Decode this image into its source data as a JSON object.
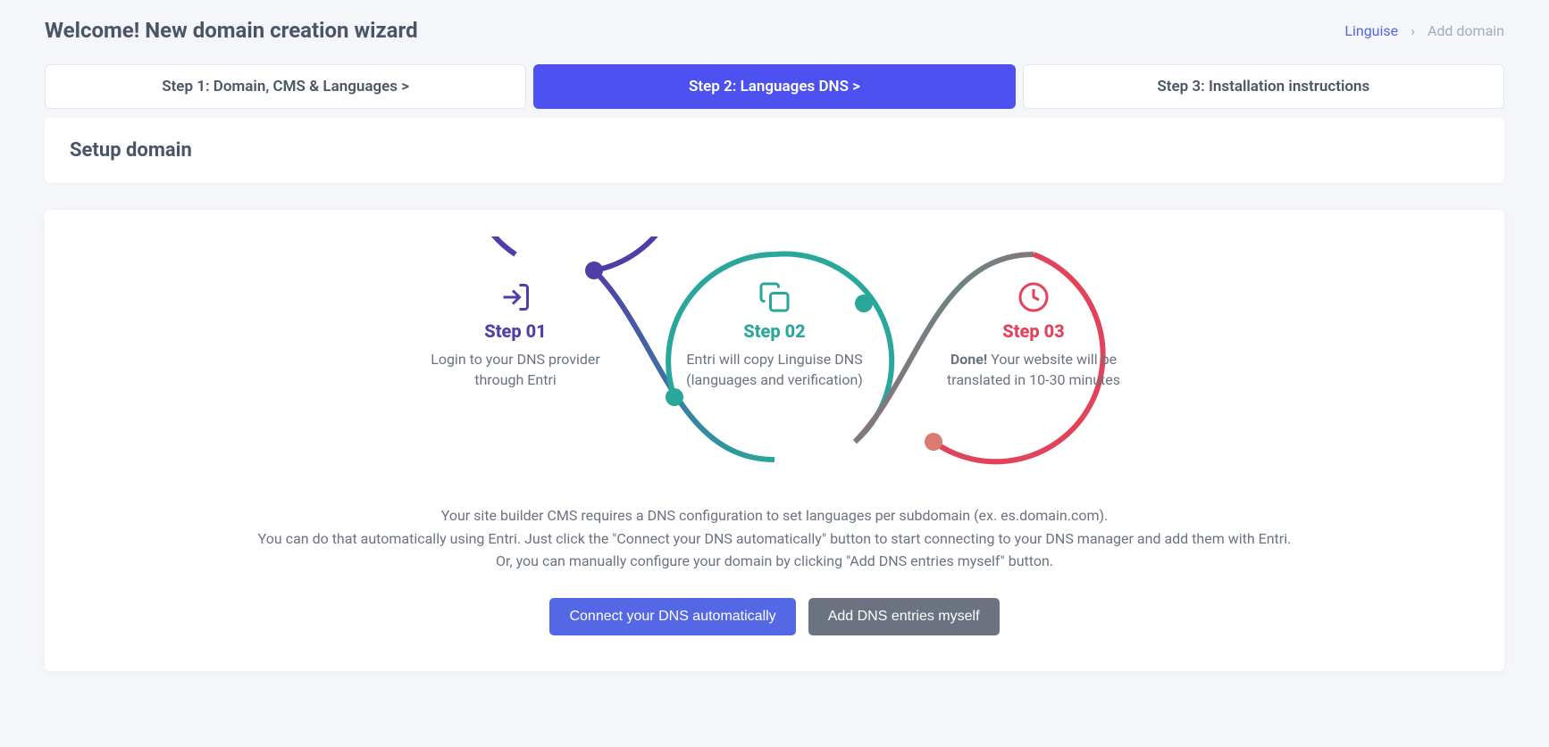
{
  "header": {
    "title": "Welcome! New domain creation wizard",
    "breadcrumb": {
      "link": "Linguise",
      "current": "Add domain"
    }
  },
  "steps_nav": [
    "Step 1: Domain, CMS & Languages  >",
    "Step 2: Languages DNS  >",
    "Step 3: Installation instructions"
  ],
  "panel": {
    "title": "Setup domain"
  },
  "diagram": {
    "step1": {
      "title": "Step 01",
      "text": "Login to your DNS provider through Entri"
    },
    "step2": {
      "title": "Step 02",
      "text": "Entri will copy Linguise DNS (languages and verification)"
    },
    "step3": {
      "title": "Step 03",
      "bold": "Done!",
      "text": " Your website will be translated in 10-30 minutes"
    }
  },
  "description": {
    "line1": "Your site builder CMS requires a DNS configuration to set languages per subdomain (ex. es.domain.com).",
    "line2": "You can do that automatically using Entri. Just click the \"Connect your DNS automatically\" button to start connecting to your DNS manager and add them with Entri.",
    "line3": "Or, you can manually configure your domain by clicking \"Add DNS entries myself\" button."
  },
  "buttons": {
    "connect": "Connect your DNS automatically",
    "manual": "Add DNS entries myself"
  }
}
